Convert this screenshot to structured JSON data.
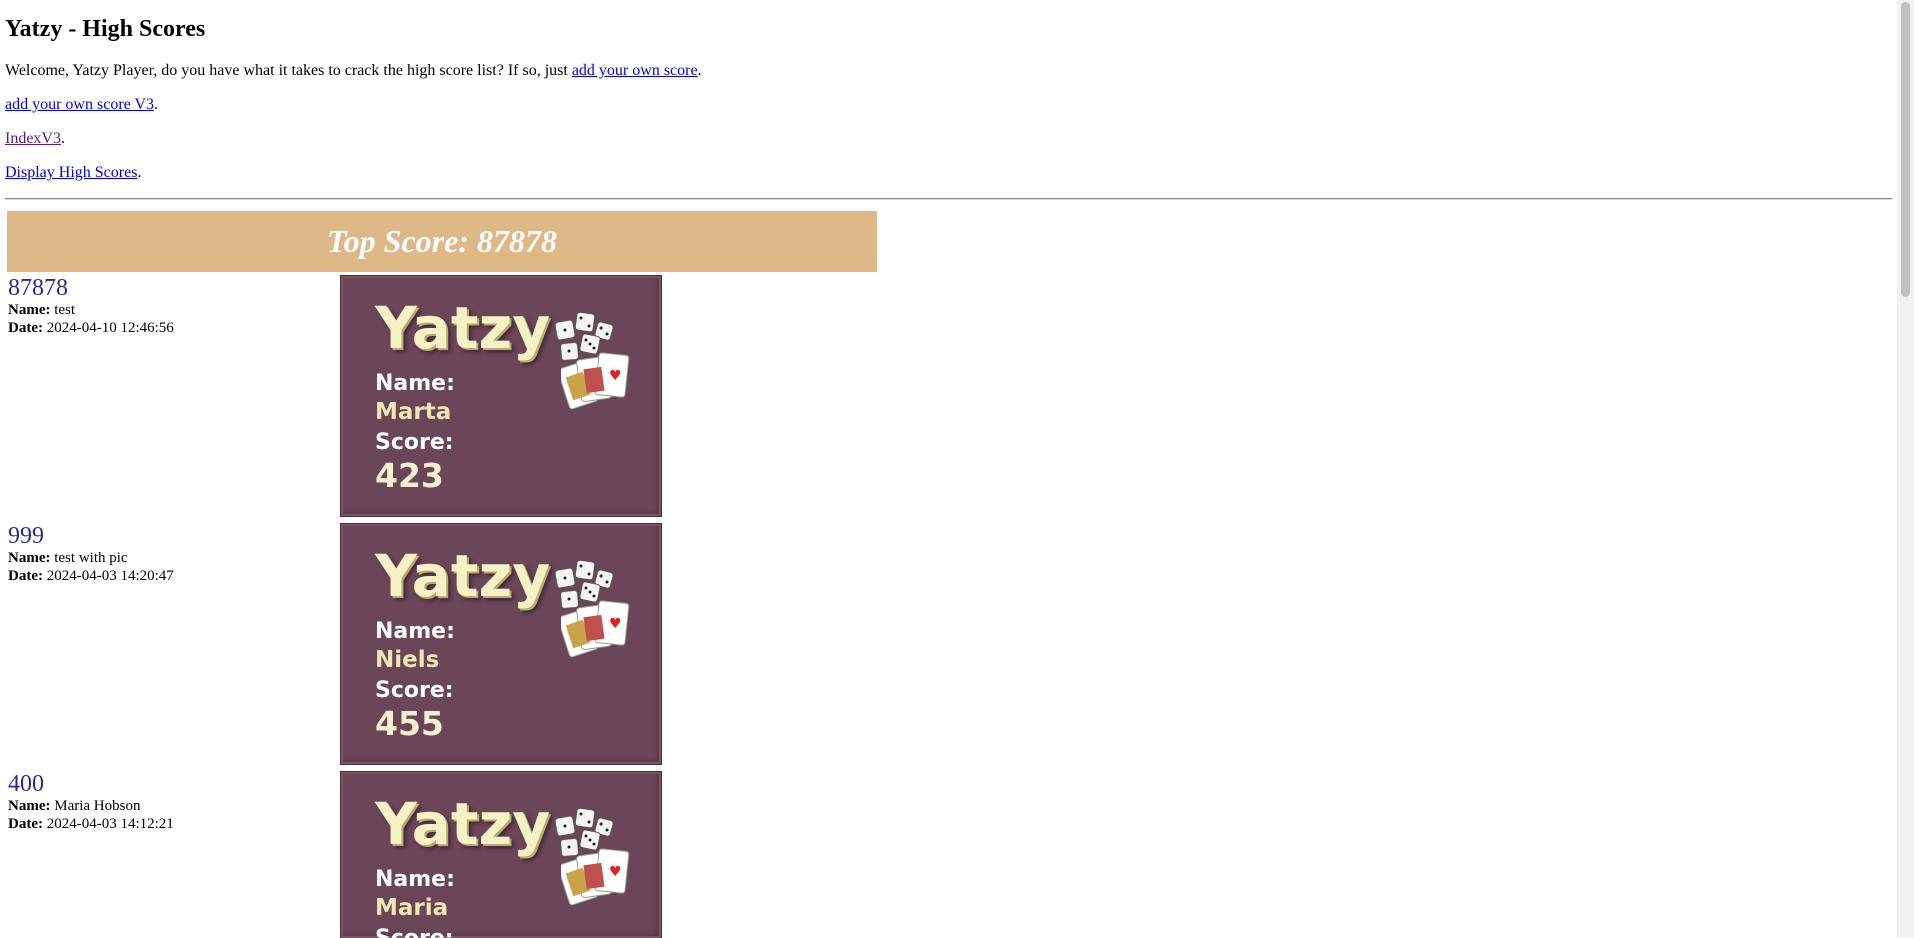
{
  "page": {
    "title": "Yatzy - High Scores",
    "welcome_text": "Welcome, Yatzy Player, do you have what it takes to crack the high score list? If so, just ",
    "welcome_link": "add your own score",
    "links": [
      {
        "label": "add your own score V3"
      },
      {
        "label": "IndexV3"
      },
      {
        "label": "Display High Scores"
      }
    ],
    "period": "."
  },
  "banner": {
    "label": "Top Score: 87878"
  },
  "labels": {
    "name": "Name:",
    "date": "Date:"
  },
  "entries": [
    {
      "score": "87878",
      "name": "test",
      "date": "2024-04-10 12:46:56",
      "card": {
        "logo": "Yatzy",
        "name_label": "Name:",
        "name": "Marta",
        "score_label": "Score:",
        "score": "423"
      }
    },
    {
      "score": "999",
      "name": "test with pic",
      "date": "2024-04-03 14:20:47",
      "card": {
        "logo": "Yatzy",
        "name_label": "Name:",
        "name": "Niels",
        "score_label": "Score:",
        "score": "455"
      }
    },
    {
      "score": "400",
      "name": "Maria Hobson",
      "date": "2024-04-03 14:12:21",
      "card": {
        "logo": "Yatzy",
        "name_label": "Name:",
        "name": "Maria",
        "score_label": "Score:",
        "score": ""
      }
    }
  ],
  "colors": {
    "banner": "#deb887",
    "card": "#6b4558",
    "score": "#2a2a8e"
  }
}
